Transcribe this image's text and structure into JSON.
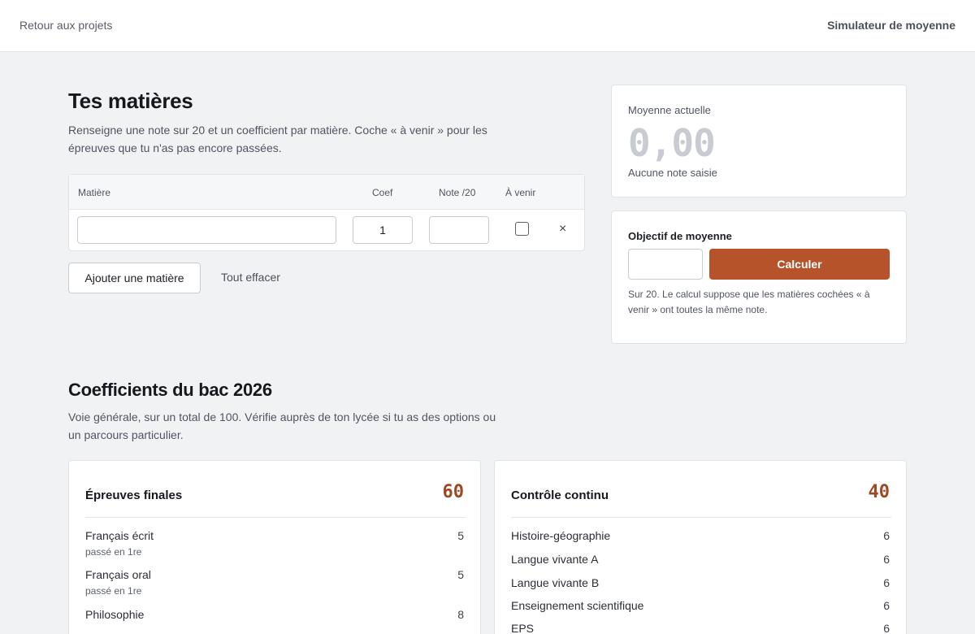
{
  "header": {
    "back_link": "Retour aux projets",
    "app_title": "Simulateur de moyenne"
  },
  "subjects": {
    "title": "Tes matières",
    "description": "Renseigne une note sur 20 et un coefficient par matière. Coche « à venir » pour les épreuves que tu n'as pas encore passées.",
    "columns": {
      "matiere": "Matière",
      "coef": "Coef",
      "note": "Note /20",
      "a_venir": "À venir"
    },
    "rows": [
      {
        "matiere": "",
        "coef": "1",
        "note": "",
        "a_venir": false
      }
    ],
    "remove_icon": "×",
    "add_label": "Ajouter une matière",
    "clear_label": "Tout effacer"
  },
  "average": {
    "label": "Moyenne actuelle",
    "value": "0,00",
    "status": "Aucune note saisie"
  },
  "goal": {
    "label": "Objectif de moyenne",
    "input_value": "",
    "button_label": "Calculer",
    "note": "Sur 20. Le calcul suppose que les matières cochées « à venir » ont toutes la même note.",
    "accent_color": "#b7532b"
  },
  "coefficients": {
    "title": "Coefficients du bac 2026",
    "description": "Voie générale, sur un total de 100. Vérifie auprès de ton lycée si tu as des options ou un parcours particulier.",
    "final": {
      "title": "Épreuves finales",
      "total": "60",
      "items": [
        {
          "name": "Français écrit",
          "coef": "5",
          "note": "passé en 1re"
        },
        {
          "name": "Français oral",
          "coef": "5",
          "note": "passé en 1re"
        },
        {
          "name": "Philosophie",
          "coef": "8"
        }
      ]
    },
    "continuous": {
      "title": "Contrôle continu",
      "total": "40",
      "items": [
        {
          "name": "Histoire-géographie",
          "coef": "6"
        },
        {
          "name": "Langue vivante A",
          "coef": "6"
        },
        {
          "name": "Langue vivante B",
          "coef": "6"
        },
        {
          "name": "Enseignement scientifique",
          "coef": "6"
        },
        {
          "name": "EPS",
          "coef": "6"
        }
      ]
    }
  }
}
